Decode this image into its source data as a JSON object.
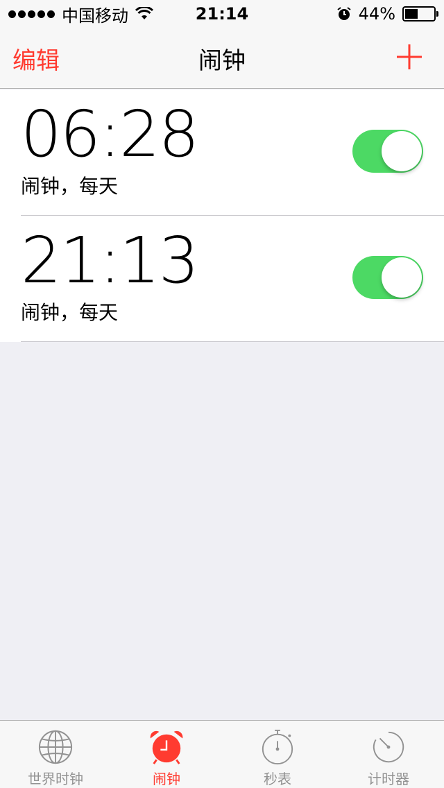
{
  "status_bar": {
    "carrier": "中国移动",
    "time": "21:14",
    "battery_percent": "44%",
    "battery_level": 0.44
  },
  "nav": {
    "edit_label": "编辑",
    "title": "闹钟"
  },
  "alarms": [
    {
      "time": "06:28",
      "label": "闹钟，每天",
      "enabled": true
    },
    {
      "time": "21:13",
      "label": "闹钟，每天",
      "enabled": true
    }
  ],
  "tabs": [
    {
      "label": "世界时钟",
      "icon": "globe-icon",
      "active": false
    },
    {
      "label": "闹钟",
      "icon": "alarm-clock-icon",
      "active": true
    },
    {
      "label": "秒表",
      "icon": "stopwatch-icon",
      "active": false
    },
    {
      "label": "计时器",
      "icon": "timer-icon",
      "active": false
    }
  ],
  "colors": {
    "accent": "#ff3b30",
    "toggle_on": "#4cd964",
    "inactive_tab": "#929292",
    "background": "#efeff4"
  }
}
